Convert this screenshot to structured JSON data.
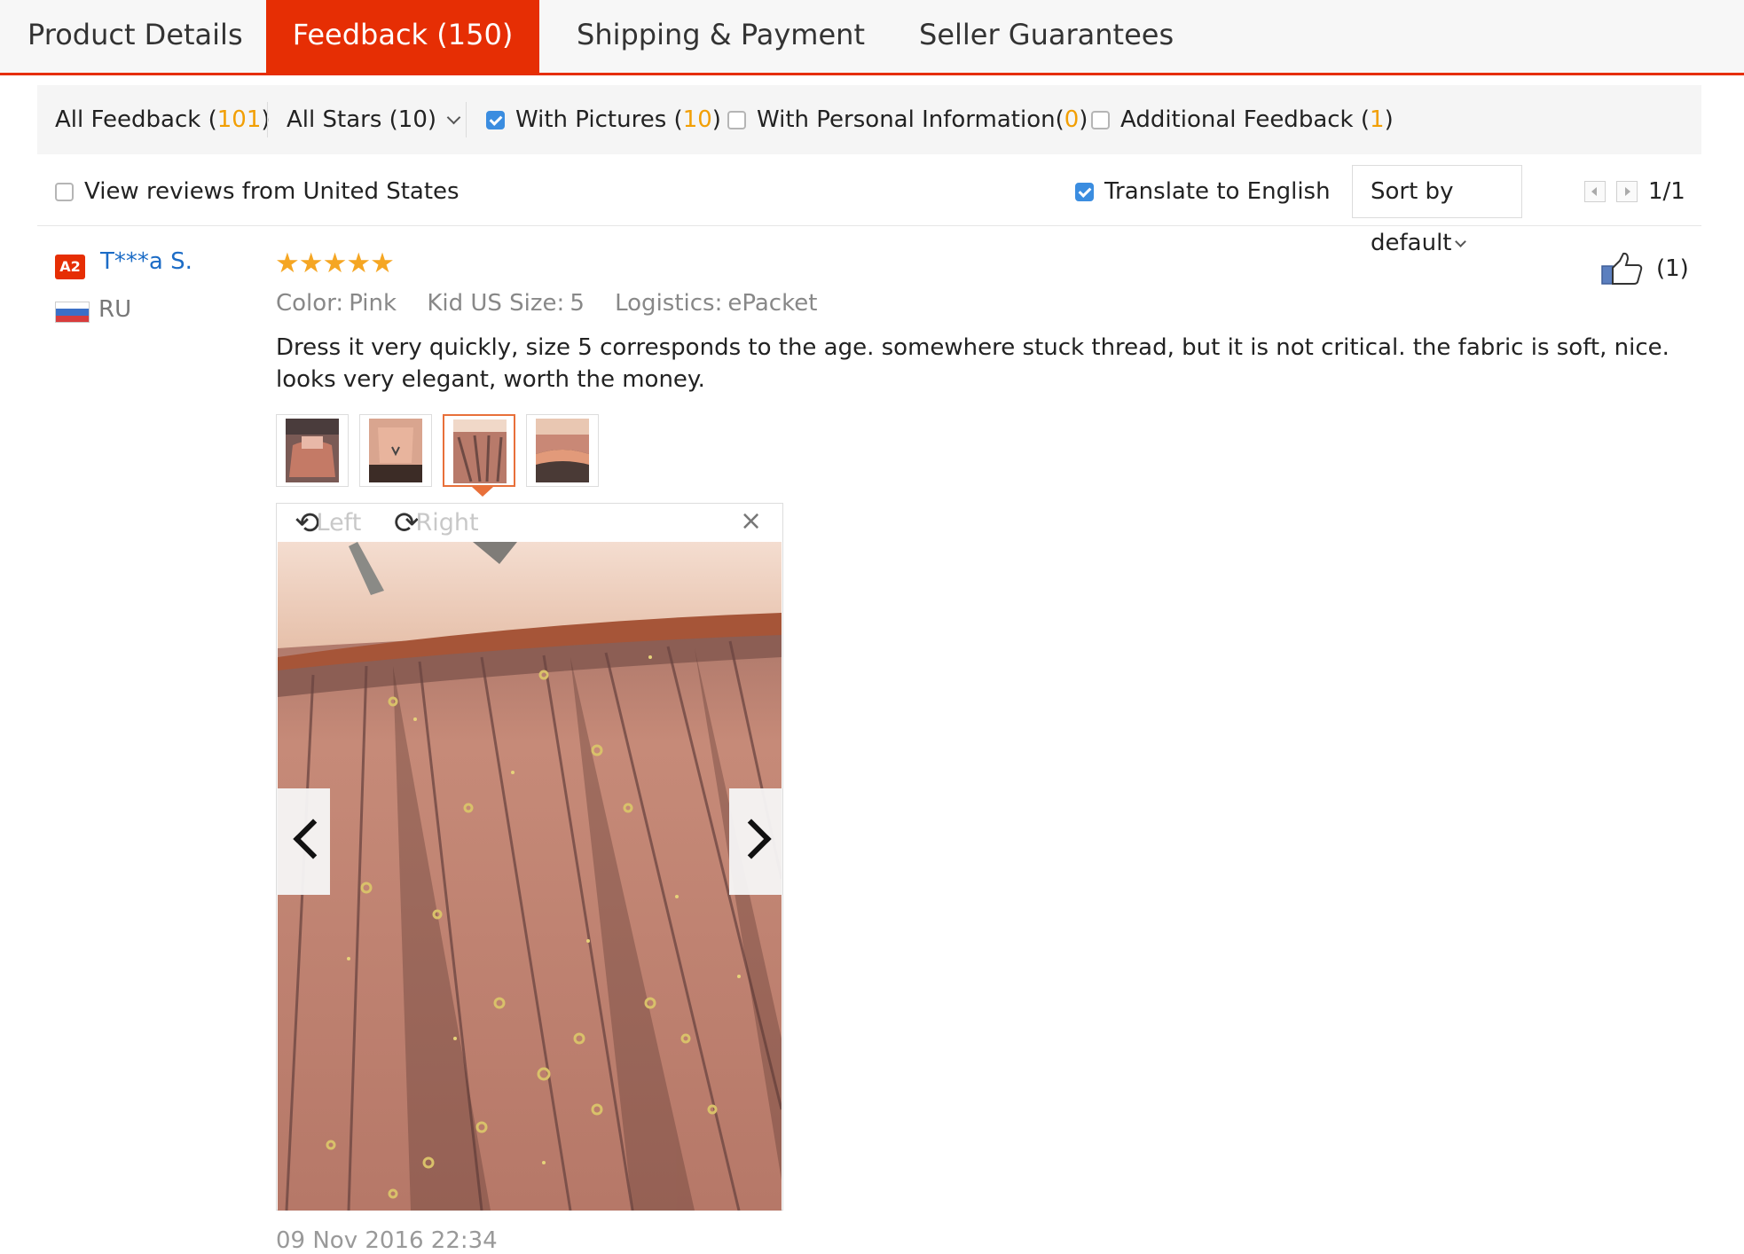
{
  "tabs": [
    {
      "label": "Product Details",
      "active": false
    },
    {
      "label": "Feedback (150)",
      "active": true
    },
    {
      "label": "Shipping & Payment",
      "active": false
    },
    {
      "label": "Seller Guarantees",
      "active": false
    }
  ],
  "filters": {
    "all_feedback": {
      "label": "All Feedback",
      "count": "101"
    },
    "all_stars": {
      "label": "All Stars (10)"
    },
    "with_pictures": {
      "label": "With Pictures",
      "count": "10",
      "checked": true
    },
    "personal_info": {
      "label": "With Personal Information",
      "count": "0",
      "checked": false
    },
    "additional": {
      "label": "Additional Feedback",
      "count": "1",
      "checked": false
    }
  },
  "options": {
    "us_reviews": {
      "label": "View reviews from United States",
      "checked": false
    },
    "translate": {
      "label": "Translate to English",
      "checked": true
    },
    "sort": {
      "label": "Sort by default"
    },
    "page": "1/1"
  },
  "review": {
    "level_badge": "A2",
    "username": "T***a S.",
    "country": "RU",
    "rating": 5,
    "stars": "★★★★★",
    "attributes": [
      {
        "label": "Color:",
        "value": "Pink"
      },
      {
        "label": "Kid US Size:",
        "value": "5"
      },
      {
        "label": "Logistics:",
        "value": "ePacket"
      }
    ],
    "text": "Dress it very quickly, size 5 corresponds to the age. somewhere stuck thread, but it is not critical. the fabric is soft, nice. looks very elegant, worth the money.",
    "thumbnails_count": 4,
    "selected_thumbnail": 3,
    "viewer": {
      "rotate_left": "Left",
      "rotate_right": "Right",
      "close": "×"
    },
    "date": "09 Nov 2016 22:34",
    "likes": "(1)"
  },
  "colors": {
    "accent": "#e62e04",
    "count_orange": "#f29f05",
    "link_blue": "#1c6cc6",
    "star": "#f5a623",
    "checkbox_checked": "#3b8de0"
  }
}
